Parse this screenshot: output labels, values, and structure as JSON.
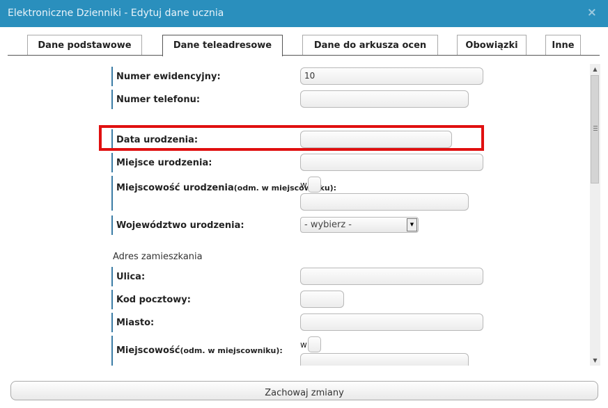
{
  "window": {
    "title": "Elektroniczne Dzienniki - Edytuj dane ucznia",
    "close_glyph": "×"
  },
  "tabs": [
    {
      "label": "Dane podstawowe",
      "active": false
    },
    {
      "label": "Dane teleadresowe",
      "active": true
    },
    {
      "label": "Dane do arkusza ocen",
      "active": false
    },
    {
      "label": "Obowiązki",
      "active": false
    },
    {
      "label": "Inne",
      "active": false
    }
  ],
  "form": {
    "numer_ewidencyjny": {
      "label": "Numer ewidencyjny:",
      "value": "10"
    },
    "numer_telefonu": {
      "label": "Numer telefonu:",
      "value": ""
    },
    "data_urodzenia": {
      "label": "Data urodzenia:",
      "value": ""
    },
    "miejsce_urodzenia": {
      "label": "Miejsce urodzenia:",
      "value": ""
    },
    "miejscowosc_urodzenia": {
      "label": "Miejscowość urodzenia",
      "note": "(odm. w miejscowniku):",
      "prefix": "w",
      "value": ""
    },
    "wojewodztwo_urodzenia": {
      "label": "Województwo urodzenia:",
      "selected": "- wybierz -"
    },
    "adres_section": "Adres zamieszkania",
    "ulica": {
      "label": "Ulica:",
      "value": ""
    },
    "kod_pocztowy": {
      "label": "Kod pocztowy:",
      "value": ""
    },
    "miasto": {
      "label": "Miasto:",
      "value": ""
    },
    "miejscowosc": {
      "label": "Miejscowość",
      "note": "(odm. w miejscowniku):",
      "prefix": "w",
      "value": ""
    }
  },
  "save_button": "Zachowaj zmiany",
  "highlight_color": "#e01010",
  "accent_color": "#2a8fbd"
}
